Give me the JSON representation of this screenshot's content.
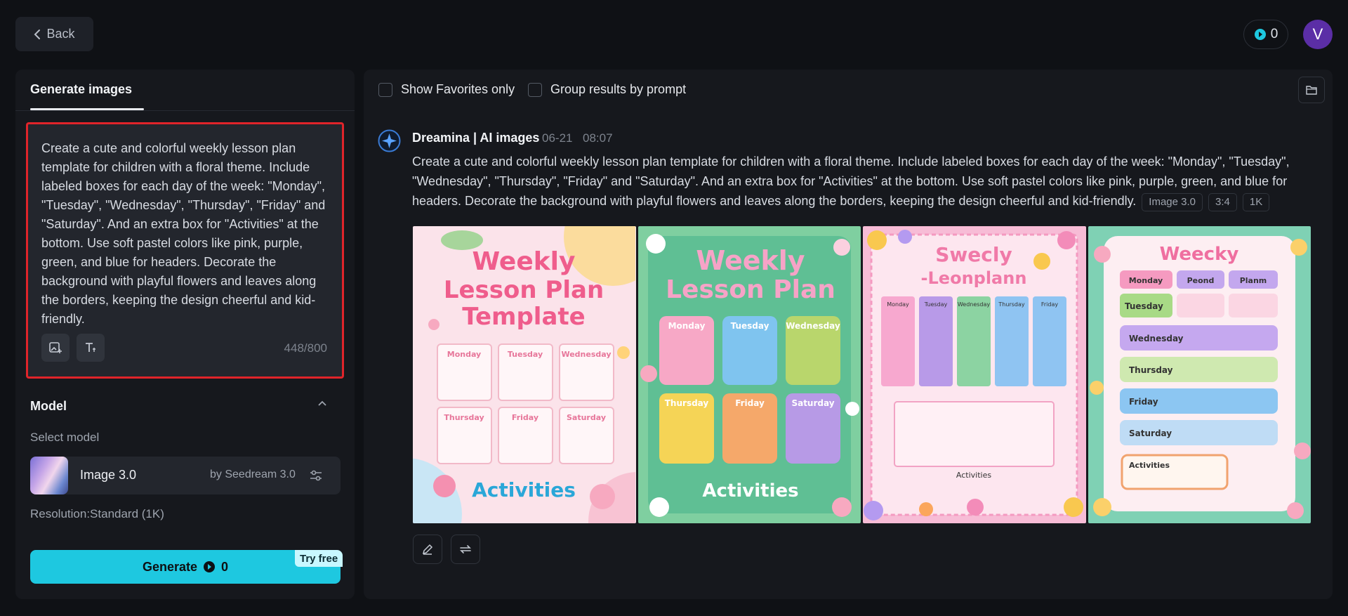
{
  "topbar": {
    "back_label": "Back",
    "credits": "0",
    "avatar_letter": "V"
  },
  "left": {
    "tab_generate": "Generate images",
    "prompt": "Create a cute and colorful weekly lesson plan template for children with a floral theme. Include labeled boxes for each day of the week: \"Monday\", \"Tuesday\", \"Wednesday\", \"Thursday\", \"Friday\" and \"Saturday\". And an extra box for \"Activities\" at the bottom. Use soft pastel colors like pink, purple, green, and blue for headers. Decorate the background with playful flowers and leaves along the borders, keeping the design cheerful and kid-friendly.",
    "char_count": "448/800",
    "model_title": "Model",
    "select_label": "Select model",
    "model_name": "Image 3.0",
    "model_by": "by Seedream 3.0",
    "resolution": "Resolution:Standard (1K)",
    "generate_label": "Generate",
    "generate_cost": "0",
    "try_free": "Try free"
  },
  "right": {
    "show_favorites": "Show Favorites only",
    "group_results": "Group results by prompt",
    "author": "Dreamina | AI images",
    "date": "06-21",
    "time": "08:07",
    "prompt": "Create a cute and colorful weekly lesson plan template for children with a floral theme. Include labeled boxes for each day of the week: \"Monday\", \"Tuesday\", \"Wednesday\", \"Thursday\", \"Friday\" and \"Saturday\". And an extra box for \"Activities\" at the bottom. Use soft pastel colors like pink, purple, green, and blue for headers. Decorate the background with playful flowers and leaves along the borders, keeping the design cheerful and kid-friendly.",
    "tags": [
      "Image 3.0",
      "3:4",
      "1K"
    ],
    "images": [
      {
        "title_lines": [
          "Weekly",
          "Lesson Plan",
          "Template"
        ],
        "days": [
          "Monday",
          "Tuesday",
          "Wednesday",
          "Thursday",
          "Friday",
          "Saturday"
        ],
        "activities": "Activities"
      },
      {
        "title_lines": [
          "Weekly",
          "Lesson Plan"
        ],
        "days": [
          "Monday",
          "Tuesday",
          "Wednesday",
          "Thursday",
          "Friday",
          "Saturday"
        ],
        "activities": "Activities"
      },
      {
        "title_lines": [
          "Swecly",
          "-Leonplann"
        ],
        "days": [
          "Monday",
          "Tuesday",
          "Wednesday",
          "Thursday",
          "Friday"
        ],
        "activities": "Activities"
      },
      {
        "title_lines": [
          "Weecky"
        ],
        "top_row": [
          "Monday",
          "Peond",
          "Planm"
        ],
        "days": [
          "Tuesday",
          "Wednesday",
          "Thursday",
          "Friday",
          "Saturday"
        ],
        "activities": "Activities"
      }
    ]
  },
  "colors": {
    "accent": "#1ec8e0",
    "highlight_border": "#e0242a",
    "avatar": "#5b2ea6"
  },
  "icons": [
    "chevron-left-icon",
    "credit-icon",
    "image-add-icon",
    "text-style-icon",
    "chevron-up-icon",
    "settings-sliders-icon",
    "folder-icon",
    "dreamina-logo-icon",
    "edit-icon",
    "regenerate-icon"
  ]
}
